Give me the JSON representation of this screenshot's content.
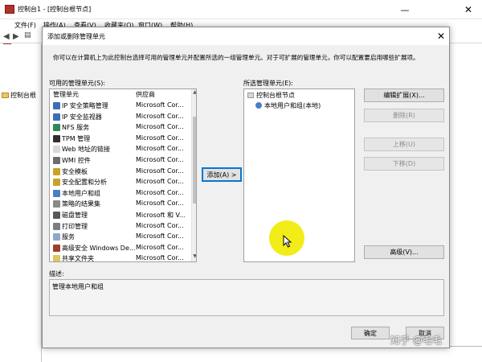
{
  "app": {
    "title": "控制台1 - [控制台根节点]",
    "minimize": "—",
    "close": "✕",
    "menu": [
      "文件(F)",
      "操作(A)",
      "查看(V)",
      "收藏夹(O)",
      "窗口(W)",
      "帮助(H)"
    ],
    "tree_root": "控制台根"
  },
  "dialog": {
    "title": "添加或删除管理单元",
    "close": "✕",
    "description": "你可以在计算机上为此控制台选择可用的管理单元并配置所选的一组管理单元。对于可扩展的管理单元，你可以配置要启用哪些扩展项。",
    "available_label": "可用的管理单元(S):",
    "columns": {
      "name": "管理单元",
      "vendor": "供应商"
    },
    "available": [
      {
        "name": "IP 安全策略管理",
        "vendor": "Microsoft Cor...",
        "icon": "ip-security-policy-icon",
        "color": "#3b6fb6"
      },
      {
        "name": "IP 安全监视器",
        "vendor": "Microsoft Cor...",
        "icon": "ip-security-monitor-icon",
        "color": "#3b6fb6"
      },
      {
        "name": "NFS 服务",
        "vendor": "Microsoft Cor...",
        "icon": "nfs-service-icon",
        "color": "#2e8b57"
      },
      {
        "name": "TPM 管理",
        "vendor": "Microsoft Cor...",
        "icon": "tpm-icon",
        "color": "#2f2f2f"
      },
      {
        "name": "Web 地址的链接",
        "vendor": "Microsoft Cor...",
        "icon": "web-link-icon",
        "color": "#d9d9d9"
      },
      {
        "name": "WMI 控件",
        "vendor": "Microsoft Cor...",
        "icon": "wmi-control-icon",
        "color": "#6d6d6d"
      },
      {
        "name": "安全模板",
        "vendor": "Microsoft Cor...",
        "icon": "security-template-icon",
        "color": "#c9a227"
      },
      {
        "name": "安全配置和分析",
        "vendor": "Microsoft Cor...",
        "icon": "security-config-icon",
        "color": "#c9a227"
      },
      {
        "name": "本地用户和组",
        "vendor": "Microsoft Cor...",
        "icon": "local-users-icon",
        "color": "#4a7fc1"
      },
      {
        "name": "策略的结果集",
        "vendor": "Microsoft Cor...",
        "icon": "policy-result-icon",
        "color": "#8a8a8a"
      },
      {
        "name": "磁盘管理",
        "vendor": "Microsoft 和 V...",
        "icon": "disk-management-icon",
        "color": "#5a5a5a"
      },
      {
        "name": "打印管理",
        "vendor": "Microsoft Cor...",
        "icon": "print-management-icon",
        "color": "#7d7d7d"
      },
      {
        "name": "服务",
        "vendor": "Microsoft Cor...",
        "icon": "services-icon",
        "color": "#8fa7c9"
      },
      {
        "name": "高级安全 Windows De...",
        "vendor": "Microsoft Cor...",
        "icon": "firewall-icon",
        "color": "#a33c2c"
      },
      {
        "name": "共享文件夹",
        "vendor": "Microsoft Cor...",
        "icon": "shared-folder-icon",
        "color": "#e3c35e"
      }
    ],
    "add_button": "添加(A) >",
    "selected_label": "所选管理单元(E):",
    "selected_root": "控制台根节点",
    "selected_child": "本地用户和组(本地)",
    "buttons": {
      "edit_extensions": "编辑扩展(X)...",
      "remove": "删除(R)",
      "move_up": "上移(U)",
      "move_down": "下移(D)",
      "advanced": "高级(V)..."
    },
    "desc_label": "描述:",
    "desc_text": "管理本地用户和组",
    "ok": "确定",
    "cancel": "取消"
  },
  "watermark": "知乎 @毛毛",
  "colors": {
    "accent": "#0078d7",
    "cursor_highlight": "#f2ec18"
  }
}
